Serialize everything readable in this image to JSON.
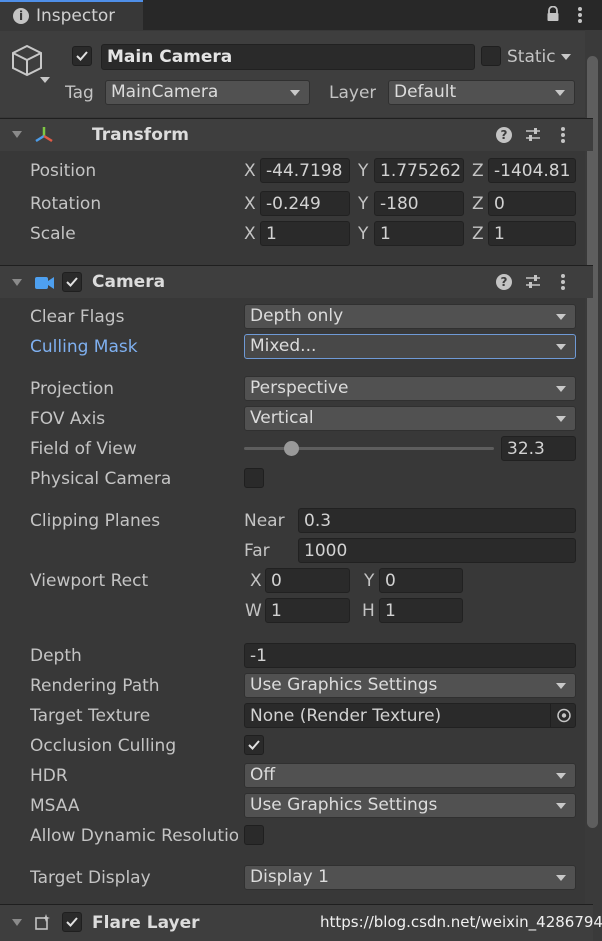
{
  "window": {
    "tab_label": "Inspector",
    "tab_icon": "info-icon"
  },
  "object": {
    "active": true,
    "name": "Main Camera",
    "static_label": "Static",
    "static_checked": false,
    "tag_label": "Tag",
    "tag_value": "MainCamera",
    "layer_label": "Layer",
    "layer_value": "Default"
  },
  "transform": {
    "title": "Transform",
    "position_label": "Position",
    "rotation_label": "Rotation",
    "scale_label": "Scale",
    "axes": {
      "x": "X",
      "y": "Y",
      "z": "Z"
    },
    "position": {
      "x": "-44.7198",
      "y": "1.775262",
      "z": "-1404.81"
    },
    "rotation": {
      "x": "-0.249",
      "y": "-180",
      "z": "0"
    },
    "scale": {
      "x": "1",
      "y": "1",
      "z": "1"
    }
  },
  "camera": {
    "title": "Camera",
    "enabled": true,
    "clear_flags_label": "Clear Flags",
    "clear_flags_value": "Depth only",
    "culling_mask_label": "Culling Mask",
    "culling_mask_value": "Mixed...",
    "projection_label": "Projection",
    "projection_value": "Perspective",
    "fov_axis_label": "FOV Axis",
    "fov_axis_value": "Vertical",
    "field_of_view_label": "Field of View",
    "field_of_view_value": "32.3",
    "field_of_view_fraction": 0.19,
    "physical_camera_label": "Physical Camera",
    "physical_camera_checked": false,
    "clipping_planes_label": "Clipping Planes",
    "near_label": "Near",
    "near_value": "0.3",
    "far_label": "Far",
    "far_value": "1000",
    "viewport_rect_label": "Viewport Rect",
    "vp_x_label": "X",
    "vp_x": "0",
    "vp_y_label": "Y",
    "vp_y": "0",
    "vp_w_label": "W",
    "vp_w": "1",
    "vp_h_label": "H",
    "vp_h": "1",
    "depth_label": "Depth",
    "depth_value": "-1",
    "rendering_path_label": "Rendering Path",
    "rendering_path_value": "Use Graphics Settings",
    "target_texture_label": "Target Texture",
    "target_texture_value": "None (Render Texture)",
    "occlusion_culling_label": "Occlusion Culling",
    "occlusion_culling_checked": true,
    "hdr_label": "HDR",
    "hdr_value": "Off",
    "msaa_label": "MSAA",
    "msaa_value": "Use Graphics Settings",
    "allow_dynamic_label": "Allow Dynamic Resolutio",
    "allow_dynamic_checked": false,
    "target_display_label": "Target Display",
    "target_display_value": "Display 1"
  },
  "flare_layer": {
    "title": "Flare Layer",
    "enabled": true
  },
  "watermark": "https://blog.csdn.net/weixin_42867940",
  "colors": {
    "accent_label": "#7fb0f0",
    "focus_border": "#6f9ad6",
    "background": "#383838",
    "header": "#3e3e3e"
  }
}
